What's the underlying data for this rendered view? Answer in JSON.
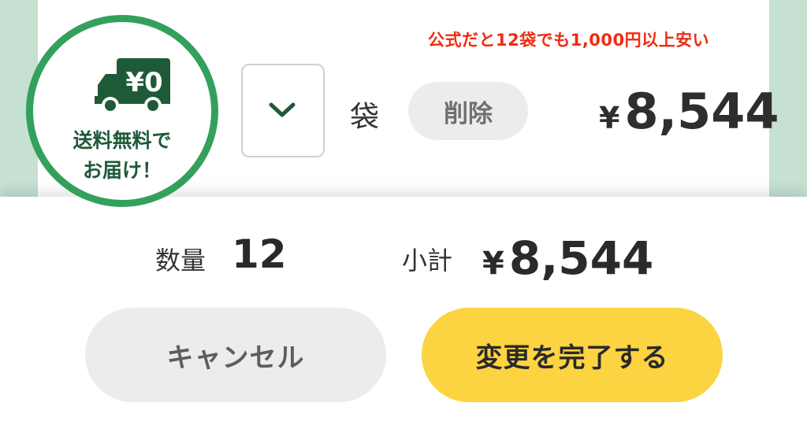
{
  "colors": {
    "background": "#c6e0d2",
    "badge_ring": "#33a05c",
    "badge_text": "#1f5a38",
    "promo": "#ef2b12",
    "confirm": "#fcd340",
    "cancel": "#ececec"
  },
  "promo_text": "公式だと12袋でも1,000円以上安い",
  "badge": {
    "icon": "truck-icon",
    "truck_label": "¥0",
    "line1": "送料無料で",
    "line2": "お届け！"
  },
  "item": {
    "unit_label": "袋",
    "delete_label": "削除",
    "price_currency": "¥",
    "price_value": "8,544",
    "select_icon": "chevron-down-icon"
  },
  "summary": {
    "quantity_label": "数量",
    "quantity_value": "12",
    "subtotal_label": "小計",
    "subtotal_currency": "¥",
    "subtotal_value": "8,544"
  },
  "actions": {
    "cancel_label": "キャンセル",
    "confirm_label": "変更を完了する"
  }
}
